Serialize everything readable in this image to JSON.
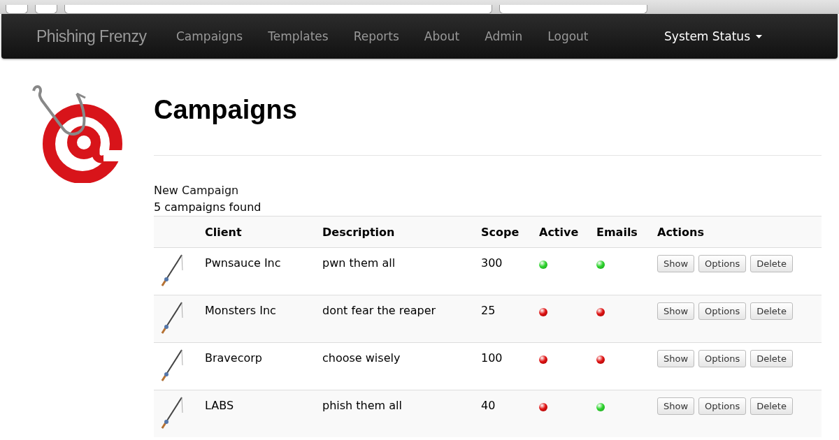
{
  "navbar": {
    "brand": "Phishing Frenzy",
    "links": [
      {
        "label": "Campaigns"
      },
      {
        "label": "Templates"
      },
      {
        "label": "Reports"
      },
      {
        "label": "About"
      },
      {
        "label": "Admin"
      },
      {
        "label": "Logout"
      }
    ],
    "status_menu": "System Status"
  },
  "page": {
    "title": "Campaigns",
    "new_link": "New Campaign",
    "count": "5 campaigns found"
  },
  "table": {
    "columns": [
      "Client",
      "Description",
      "Scope",
      "Active",
      "Emails",
      "Actions"
    ],
    "rows": [
      {
        "client": "Pwnsauce Inc",
        "description": "pwn them all",
        "scope": "300",
        "active": true,
        "emails": true,
        "actions": [
          "Show",
          "Options",
          "Delete"
        ]
      },
      {
        "client": "Monsters Inc",
        "description": "dont fear the reaper",
        "scope": "25",
        "active": false,
        "emails": false,
        "actions": [
          "Show",
          "Options",
          "Delete"
        ]
      },
      {
        "client": "Bravecorp",
        "description": "choose wisely",
        "scope": "100",
        "active": false,
        "emails": false,
        "actions": [
          "Show",
          "Options",
          "Delete"
        ]
      },
      {
        "client": "LABS",
        "description": "phish them all",
        "scope": "40",
        "active": false,
        "emails": true,
        "actions": [
          "Show",
          "Options",
          "Delete"
        ]
      }
    ]
  }
}
